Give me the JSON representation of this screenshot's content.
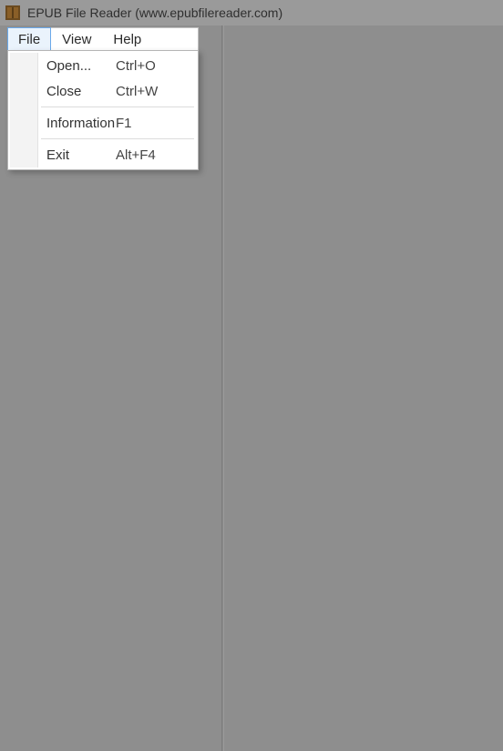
{
  "title": "EPUB File Reader (www.epubfilereader.com)",
  "menubar": {
    "file": "File",
    "view": "View",
    "help": "Help"
  },
  "file_menu": {
    "open": {
      "label": "Open...",
      "shortcut": "Ctrl+O"
    },
    "close": {
      "label": "Close",
      "shortcut": "Ctrl+W"
    },
    "information": {
      "label": "Information",
      "shortcut": "F1"
    },
    "exit": {
      "label": "Exit",
      "shortcut": "Alt+F4"
    }
  }
}
